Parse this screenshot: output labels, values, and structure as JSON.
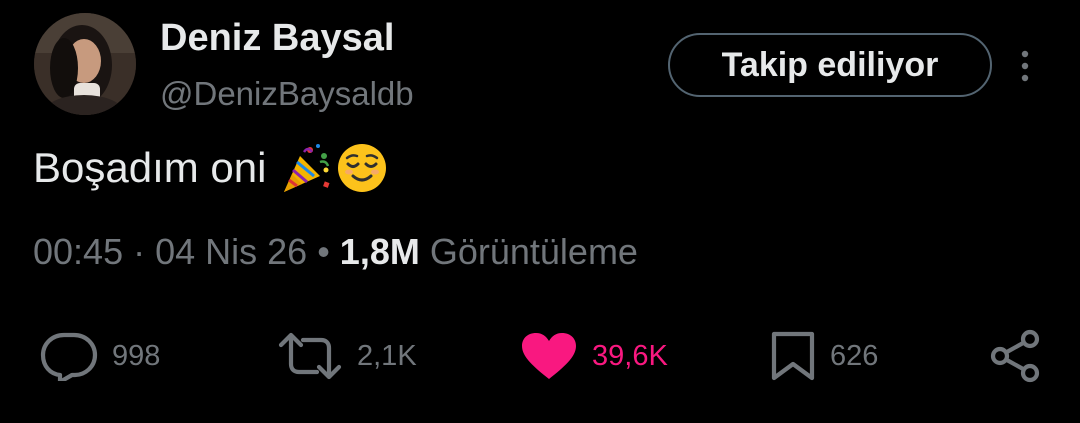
{
  "author": {
    "display_name": "Deniz Baysal",
    "handle": "@DenizBaysaldb"
  },
  "follow_button_label": "Takip ediliyor",
  "tweet": {
    "text": "Boşadım oni",
    "emojis": [
      "party-popper-icon",
      "relieved-face-icon"
    ]
  },
  "meta": {
    "time": "00:45",
    "separator1": " · ",
    "date": "04 Nis 26",
    "separator2": " • ",
    "views_count": "1,8M",
    "views_label": " Görüntüleme"
  },
  "actions": {
    "reply_count": "998",
    "retweet_count": "2,1K",
    "like_count": "39,6K",
    "bookmark_count": "626"
  },
  "colors": {
    "background": "#000000",
    "text": "#e7e9ea",
    "secondary": "#71767b",
    "like": "#f91880",
    "button_border": "#536471"
  }
}
